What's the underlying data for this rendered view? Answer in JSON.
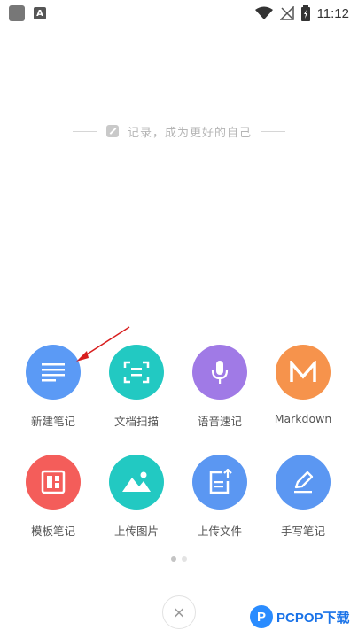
{
  "status_bar": {
    "time": "11:12"
  },
  "slogan": {
    "text": "记录，成为更好的自己"
  },
  "grid": {
    "row1": [
      {
        "label": "新建笔记",
        "color": "#5b9af5",
        "icon": "list-icon"
      },
      {
        "label": "文档扫描",
        "color": "#22c9c2",
        "icon": "scan-icon"
      },
      {
        "label": "语音速记",
        "color": "#a07ae6",
        "icon": "microphone-icon"
      },
      {
        "label": "Markdown",
        "color": "#f6934c",
        "icon": "markdown-icon",
        "glyph": "M"
      }
    ],
    "row2": [
      {
        "label": "模板笔记",
        "color": "#f45d5a",
        "icon": "template-icon"
      },
      {
        "label": "上传图片",
        "color": "#22c9c2",
        "icon": "image-icon"
      },
      {
        "label": "上传文件",
        "color": "#5b97f2",
        "icon": "upload-file-icon"
      },
      {
        "label": "手写笔记",
        "color": "#5b97f2",
        "icon": "handwriting-icon"
      }
    ]
  },
  "pager": {
    "count": 2,
    "active": 1
  },
  "close": {
    "glyph": "×"
  },
  "watermark": {
    "logo": "P",
    "text": "PCPOP下载"
  }
}
